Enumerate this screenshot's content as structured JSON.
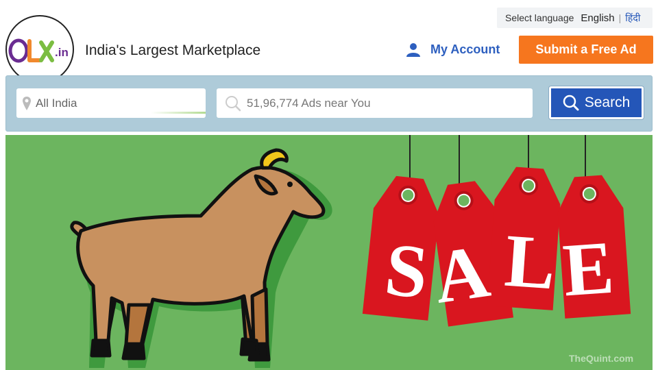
{
  "language": {
    "prompt": "Select language",
    "english": "English",
    "separator": "|",
    "hindi": "हिंदी"
  },
  "brand": {
    "logo_text": "OLX",
    "logo_suffix": ".in",
    "tagline": "India's Largest Marketplace"
  },
  "account": {
    "label": "My Account",
    "icon": "user-icon"
  },
  "submit_ad": {
    "label": "Submit a Free Ad"
  },
  "search": {
    "location_placeholder": "All India",
    "location_icon": "map-pin-icon",
    "query_placeholder": "51,96,774 Ads near You",
    "query_icon": "search-icon",
    "button_label": "Search"
  },
  "banner": {
    "tags": [
      "S",
      "A",
      "L",
      "E"
    ],
    "watermark": "TheQuint.com"
  },
  "colors": {
    "brand_blue": "#2456b8",
    "submit_orange": "#f6761e",
    "search_bar_bg": "#aecbd9",
    "banner_green": "#6cb55f",
    "tag_red": "#d9161f"
  }
}
